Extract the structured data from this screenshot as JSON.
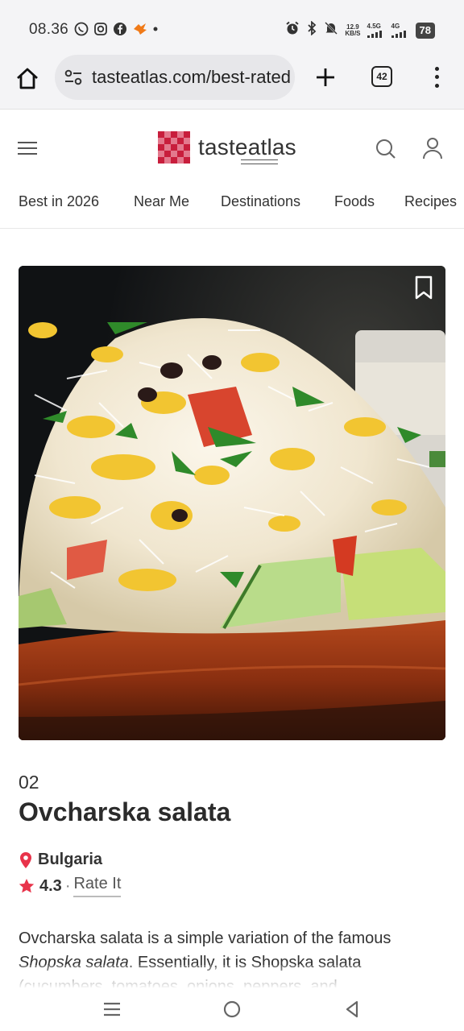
{
  "status_bar": {
    "time": "08.36",
    "left_icons": [
      "whatsapp-icon",
      "instagram-icon",
      "facebook-icon",
      "app-notification-icon",
      "dot-icon"
    ],
    "right_icons": [
      "alarm-icon",
      "bluetooth-icon",
      "mute-icon"
    ],
    "net_speed_value": "12.9",
    "net_speed_unit": "KB/S",
    "signal_1_label": "4.5G",
    "signal_2_label": "4G",
    "battery": "78"
  },
  "browser": {
    "url": "tasteatlas.com/best-rated",
    "tab_count": "42"
  },
  "site": {
    "logo_text_a": "taste",
    "logo_text_b": "atlas",
    "brand_color": "#d71f3e"
  },
  "nav": {
    "items": [
      "Best in 2026",
      "Near Me",
      "Destinations",
      "Foods",
      "Recipes"
    ]
  },
  "dish": {
    "rank": "02",
    "name": "Ovcharska salata",
    "origin": "Bulgaria",
    "rating": "4.3",
    "rating_separator": "·",
    "rate_label": "Rate It",
    "description_start": "Ovcharska salata is a simple variation of the famous ",
    "description_em": "Shopska salata",
    "description_rest": ". Essentially, it is Shopska salata (cucumbers, tomatoes, onions, peppers, and",
    "accent_color": "#e8334a"
  }
}
